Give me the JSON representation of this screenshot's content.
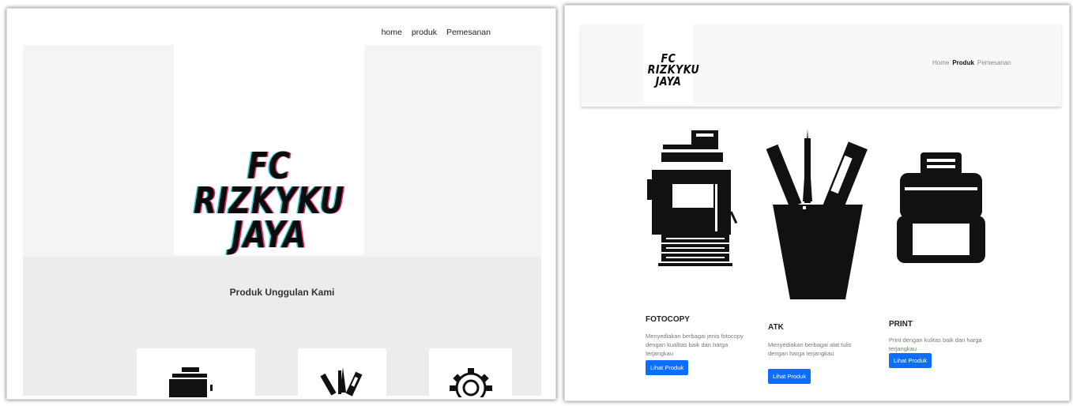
{
  "left_screenshot": {
    "nav": {
      "home": "home",
      "produk": "produk",
      "pemesanan": "Pemesanan"
    },
    "hero": {
      "logo_line1": "FC RIZKYKU",
      "logo_line2": "JAYA"
    },
    "section": {
      "title": "Produk Unggulan Kami"
    },
    "cards": [
      {
        "icon": "photocopier-icon"
      },
      {
        "icon": "stationery-cup-icon"
      },
      {
        "icon": "gear-icon"
      }
    ]
  },
  "right_screenshot": {
    "header": {
      "logo_line1": "FC RIZKYKU",
      "logo_line2": "JAYA"
    },
    "nav": {
      "home": "Home",
      "produk": "Produk",
      "pemesanan": "Pemesanan",
      "active": "Produk"
    },
    "products": [
      {
        "icon": "photocopier-icon",
        "title": "FOTOCOPY",
        "description": "Menyediakan berbagai jenis fotocopy dengan kualitas baik dan harga terjangkau",
        "button": "Lihat Produk"
      },
      {
        "icon": "stationery-cup-icon",
        "title": "ATK",
        "description": "Menyediakan berbagai alat tulis dengan harga terjangkau",
        "button": "Lihat Produk"
      },
      {
        "icon": "printer-icon",
        "title": "PRINT",
        "description": "Print dengan kulitas baik dan harga terjangkau",
        "button": "Lihat Produk"
      }
    ]
  },
  "colors": {
    "button": "#0d6efd",
    "hero_bg": "#f4f4f4",
    "section_bg": "#ececec"
  }
}
